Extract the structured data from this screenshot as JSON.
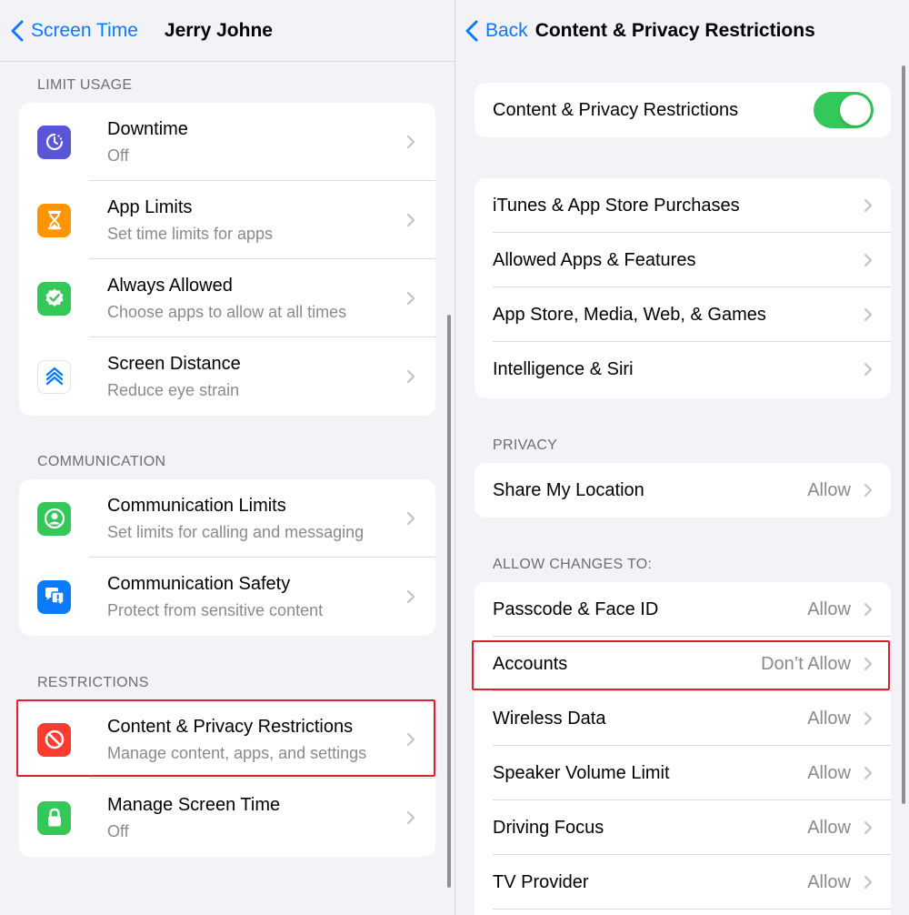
{
  "left": {
    "nav": {
      "back_label": "Screen Time",
      "title": "Jerry Johne"
    },
    "sections": [
      {
        "header": "LIMIT USAGE",
        "rows": [
          {
            "title": "Downtime",
            "subtitle": "Off",
            "icon": "downtime-icon",
            "color": "#5856d6"
          },
          {
            "title": "App Limits",
            "subtitle": "Set time limits for apps",
            "icon": "hourglass-icon",
            "color": "#ff9500"
          },
          {
            "title": "Always Allowed",
            "subtitle": "Choose apps to allow at all times",
            "icon": "checkmark-seal-icon",
            "color": "#34c759"
          },
          {
            "title": "Screen Distance",
            "subtitle": "Reduce eye strain",
            "icon": "screen-distance-icon",
            "color": "#ffffff"
          }
        ]
      },
      {
        "header": "COMMUNICATION",
        "rows": [
          {
            "title": "Communication Limits",
            "subtitle": "Set limits for calling and messaging",
            "icon": "person-circle-icon",
            "color": "#34c759"
          },
          {
            "title": "Communication Safety",
            "subtitle": "Protect from sensitive content",
            "icon": "chat-bubbles-icon",
            "color": "#0a7aff"
          }
        ]
      },
      {
        "header": "RESTRICTIONS",
        "rows": [
          {
            "title": "Content & Privacy Restrictions",
            "subtitle": "Manage content, apps, and settings",
            "icon": "no-entry-icon",
            "color": "#ff3b30"
          },
          {
            "title": "Manage Screen Time",
            "subtitle": "Off",
            "icon": "lock-icon",
            "color": "#34c759"
          }
        ]
      }
    ]
  },
  "right": {
    "nav": {
      "back_label": "Back",
      "title": "Content & Privacy Restrictions"
    },
    "master_toggle": {
      "label": "Content & Privacy Restrictions",
      "on": true
    },
    "menu_items": [
      "iTunes & App Store Purchases",
      "Allowed Apps & Features",
      "App Store, Media, Web, & Games",
      "Intelligence & Siri"
    ],
    "privacy": {
      "header": "PRIVACY",
      "rows": [
        {
          "label": "Share My Location",
          "value": "Allow"
        }
      ]
    },
    "allow_changes": {
      "header": "ALLOW CHANGES TO:",
      "rows": [
        {
          "label": "Passcode & Face ID",
          "value": "Allow"
        },
        {
          "label": "Accounts",
          "value": "Don’t Allow"
        },
        {
          "label": "Wireless Data",
          "value": "Allow"
        },
        {
          "label": "Speaker Volume Limit",
          "value": "Allow"
        },
        {
          "label": "Driving Focus",
          "value": "Allow"
        },
        {
          "label": "TV Provider",
          "value": "Allow"
        }
      ]
    }
  },
  "colors": {
    "accent": "#0a7aff",
    "toggle_on": "#34c759",
    "highlight": "#e0202e"
  }
}
